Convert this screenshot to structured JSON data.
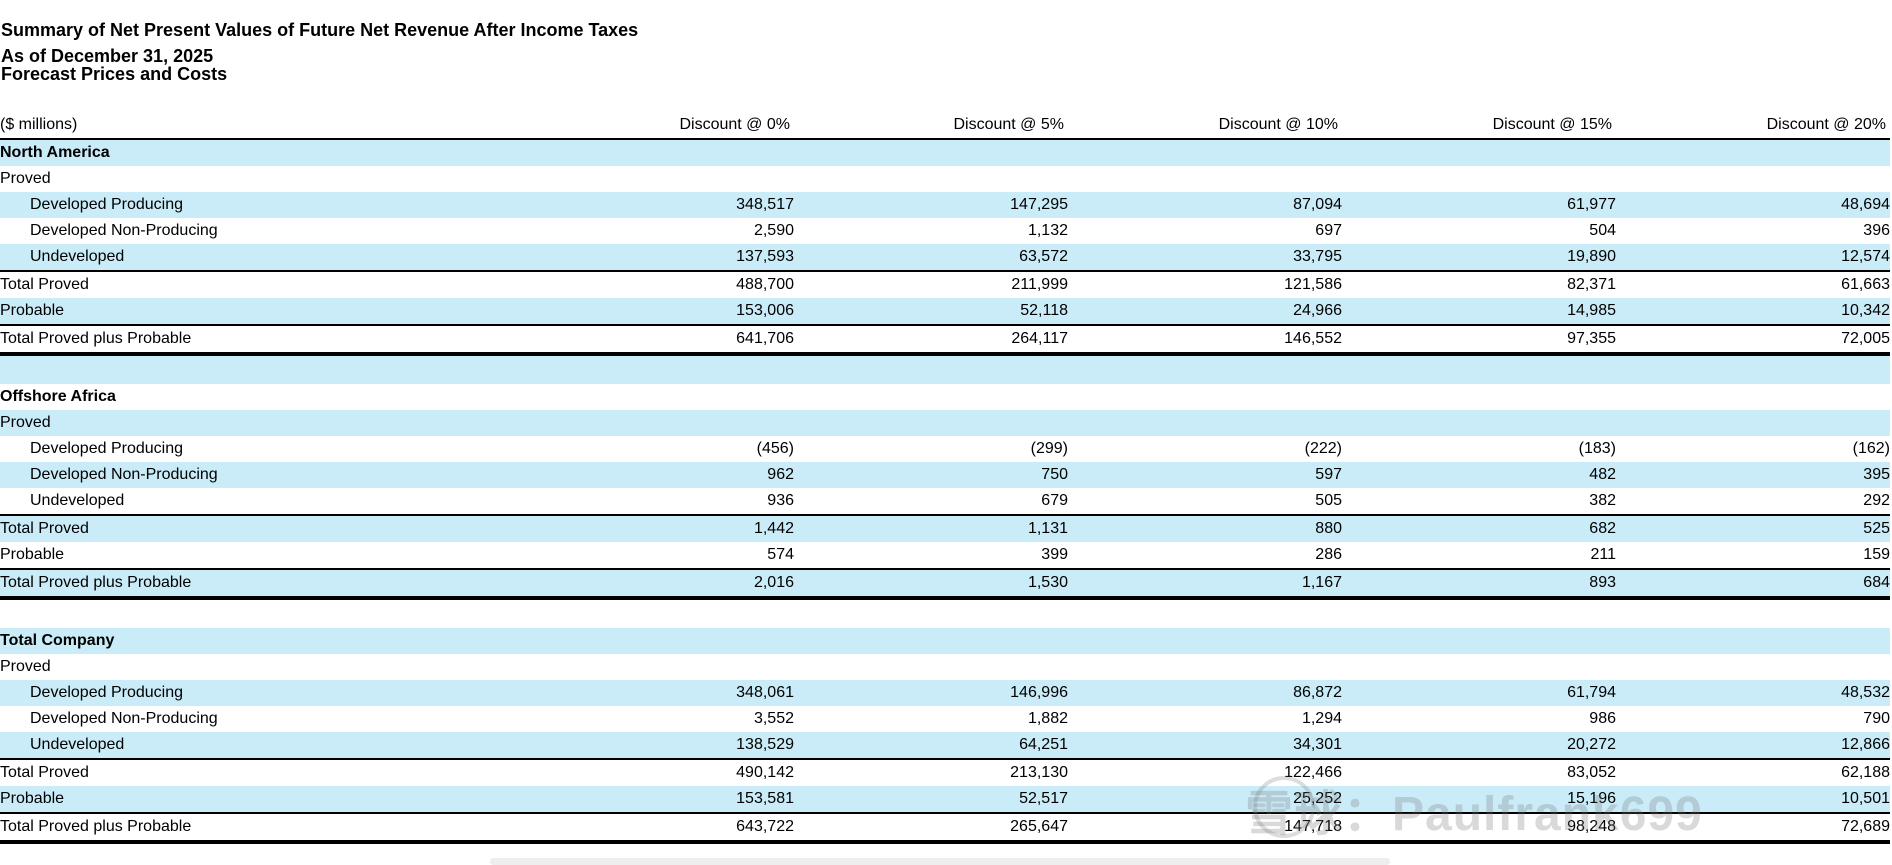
{
  "title": "Summary of Net Present Values of Future Net Revenue After Income Taxes",
  "as_of": "As of December 31, 2025",
  "basis": "Forecast Prices and Costs",
  "units_label": "($ millions)",
  "columns": [
    "Discount @ 0%",
    "Discount @ 5%",
    "Discount @ 10%",
    "Discount @ 15%",
    "Discount @ 20%"
  ],
  "sections": [
    {
      "name": "North America",
      "proved_label": "Proved",
      "rows": [
        {
          "label": "Developed Producing",
          "values": [
            "348,517",
            "147,295",
            "87,094",
            "61,977",
            "48,694"
          ]
        },
        {
          "label": "Developed Non-Producing",
          "values": [
            "2,590",
            "1,132",
            "697",
            "504",
            "396"
          ]
        },
        {
          "label": "Undeveloped",
          "values": [
            "137,593",
            "63,572",
            "33,795",
            "19,890",
            "12,574"
          ]
        },
        {
          "label": "Total Proved",
          "values": [
            "488,700",
            "211,999",
            "121,586",
            "82,371",
            "61,663"
          ]
        },
        {
          "label": "Probable",
          "values": [
            "153,006",
            "52,118",
            "24,966",
            "14,985",
            "10,342"
          ]
        },
        {
          "label": "Total Proved plus Probable",
          "values": [
            "641,706",
            "264,117",
            "146,552",
            "97,355",
            "72,005"
          ]
        }
      ]
    },
    {
      "name": "Offshore Africa",
      "proved_label": "Proved",
      "rows": [
        {
          "label": "Developed Producing",
          "values": [
            "(456)",
            "(299)",
            "(222)",
            "(183)",
            "(162)"
          ]
        },
        {
          "label": "Developed Non-Producing",
          "values": [
            "962",
            "750",
            "597",
            "482",
            "395"
          ]
        },
        {
          "label": "Undeveloped",
          "values": [
            "936",
            "679",
            "505",
            "382",
            "292"
          ]
        },
        {
          "label": "Total Proved",
          "values": [
            "1,442",
            "1,131",
            "880",
            "682",
            "525"
          ]
        },
        {
          "label": "Probable",
          "values": [
            "574",
            "399",
            "286",
            "211",
            "159"
          ]
        },
        {
          "label": "Total Proved plus Probable",
          "values": [
            "2,016",
            "1,530",
            "1,167",
            "893",
            "684"
          ]
        }
      ]
    },
    {
      "name": "Total Company",
      "proved_label": "Proved",
      "rows": [
        {
          "label": "Developed Producing",
          "values": [
            "348,061",
            "146,996",
            "86,872",
            "61,794",
            "48,532"
          ]
        },
        {
          "label": "Developed Non-Producing",
          "values": [
            "3,552",
            "1,882",
            "1,294",
            "986",
            "790"
          ]
        },
        {
          "label": "Undeveloped",
          "values": [
            "138,529",
            "64,251",
            "34,301",
            "20,272",
            "12,866"
          ]
        },
        {
          "label": "Total Proved",
          "values": [
            "490,142",
            "213,130",
            "122,466",
            "83,052",
            "62,188"
          ]
        },
        {
          "label": "Probable",
          "values": [
            "153,581",
            "52,517",
            "25,252",
            "15,196",
            "10,501"
          ]
        },
        {
          "label": "Total Proved plus Probable",
          "values": [
            "643,722",
            "265,647",
            "147,718",
            "98,248",
            "72,689"
          ]
        }
      ]
    }
  ],
  "watermark": "雪球：Paulfrank699",
  "colors": {
    "row_highlight": "#c9ecf8",
    "rule": "#000000"
  }
}
